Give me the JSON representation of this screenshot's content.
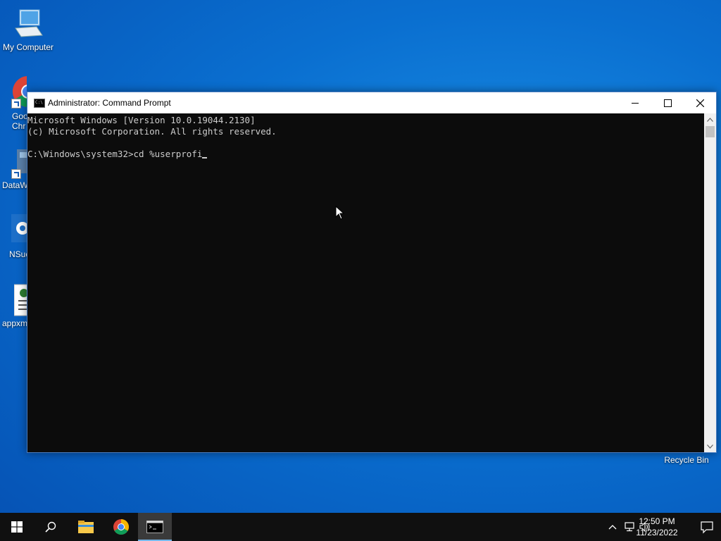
{
  "desktop": {
    "icons": [
      {
        "label": "My Computer"
      },
      {
        "label": "Google Chrome",
        "short_label": "Goo\nChr"
      },
      {
        "label": "DataW",
        "short_label": "DataW"
      },
      {
        "label": "NSuc",
        "short_label": "NSuc"
      },
      {
        "label": "appxm",
        "short_label": "appxm"
      },
      {
        "label": "Recycle Bin"
      }
    ]
  },
  "window": {
    "title": "Administrator: Command Prompt",
    "console_lines": [
      "Microsoft Windows [Version 10.0.19044.2130]",
      "(c) Microsoft Corporation. All rights reserved.",
      "",
      "C:\\Windows\\system32>cd %userprofi"
    ]
  },
  "taskbar": {
    "time": "12:50 PM",
    "date": "11/23/2022"
  }
}
